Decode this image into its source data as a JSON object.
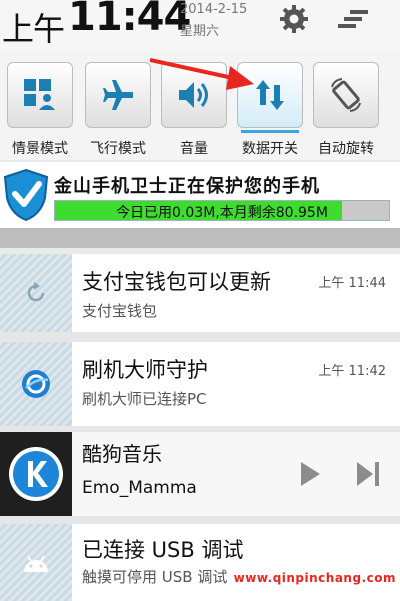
{
  "status": {
    "ampm": "上午",
    "clock": "11:44",
    "date": "2014-2-15",
    "weekday": "星期六",
    "settings_icon": "gear-icon",
    "menu_icon": "menu-bars-icon"
  },
  "toggles": [
    {
      "label": "情景模式",
      "icon": "profile-mode-icon",
      "active": false
    },
    {
      "label": "飞行模式",
      "icon": "airplane-icon",
      "active": false
    },
    {
      "label": "音量",
      "icon": "speaker-icon",
      "active": false
    },
    {
      "label": "数据开关",
      "icon": "data-arrows-icon",
      "active": true
    },
    {
      "label": "自动旋转",
      "icon": "rotate-icon",
      "active": false
    }
  ],
  "guard": {
    "title": "金山手机卫士正在保护您的手机",
    "usage_text": "今日已用0.03M,本月剩余80.95M",
    "usage_fraction": 0.86,
    "icon": "shield-check-icon"
  },
  "notifications": [
    {
      "title": "支付宝钱包可以更新",
      "subtitle": "支付宝钱包",
      "time": "上午 11:44",
      "icon": "refresh-icon"
    },
    {
      "title": "刷机大师守护",
      "subtitle": "刷机大师已连接PC",
      "time": "上午 11:42",
      "icon": "flash-master-icon"
    }
  ],
  "music": {
    "title": "酷狗音乐",
    "artist": "Emo_Mamma",
    "icon": "kugou-k-icon"
  },
  "usb": {
    "title": "已连接 USB 调试",
    "subtitle": "触摸可停用 USB 调试",
    "icon": "android-icon"
  },
  "watermark": "www.qinpinchang.com",
  "colors": {
    "accent": "#3aa6d9",
    "arrow": "#e8261f",
    "usage_fill": "#3ddc2e"
  }
}
